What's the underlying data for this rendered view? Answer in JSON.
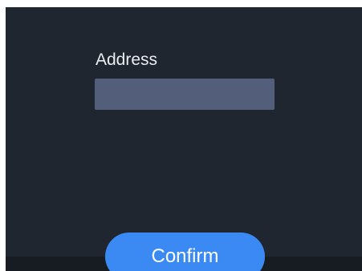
{
  "form": {
    "address_label": "Address",
    "address_value": "",
    "confirm_label": "Confirm"
  },
  "colors": {
    "background": "#1f2630",
    "input": "#535f7a",
    "accent": "#3b8af3"
  }
}
